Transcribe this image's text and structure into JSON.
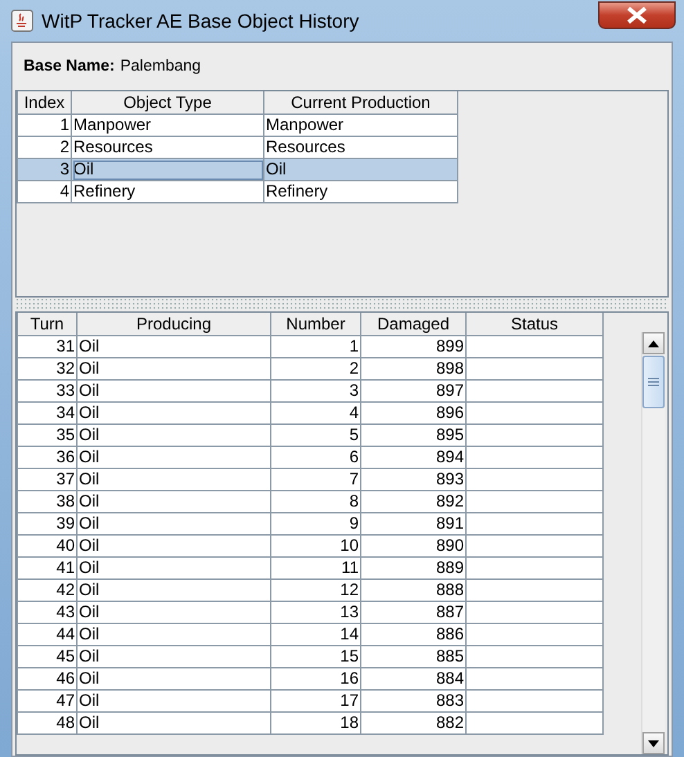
{
  "window": {
    "title": "WitP Tracker AE Base Object History"
  },
  "base_name": {
    "label": "Base Name:",
    "value": "Palembang"
  },
  "objects_table": {
    "columns": [
      "Index",
      "Object Type",
      "Current Production"
    ],
    "rows": [
      {
        "cells": [
          "1",
          "Manpower",
          "Manpower"
        ],
        "selected": false
      },
      {
        "cells": [
          "2",
          "Resources",
          "Resources"
        ],
        "selected": false
      },
      {
        "cells": [
          "3",
          "Oil",
          "Oil"
        ],
        "selected": true
      },
      {
        "cells": [
          "4",
          "Refinery",
          "Refinery"
        ],
        "selected": false
      }
    ]
  },
  "history_table": {
    "columns": [
      "Turn",
      "Producing",
      "Number",
      "Damaged",
      "Status"
    ],
    "rows": [
      [
        "31",
        "Oil",
        "1",
        "899"
      ],
      [
        "32",
        "Oil",
        "2",
        "898"
      ],
      [
        "33",
        "Oil",
        "3",
        "897"
      ],
      [
        "34",
        "Oil",
        "4",
        "896"
      ],
      [
        "35",
        "Oil",
        "5",
        "895"
      ],
      [
        "36",
        "Oil",
        "6",
        "894"
      ],
      [
        "37",
        "Oil",
        "7",
        "893"
      ],
      [
        "38",
        "Oil",
        "8",
        "892"
      ],
      [
        "39",
        "Oil",
        "9",
        "891"
      ],
      [
        "40",
        "Oil",
        "10",
        "890"
      ],
      [
        "41",
        "Oil",
        "11",
        "889"
      ],
      [
        "42",
        "Oil",
        "12",
        "888"
      ],
      [
        "43",
        "Oil",
        "13",
        "887"
      ],
      [
        "44",
        "Oil",
        "14",
        "886"
      ],
      [
        "45",
        "Oil",
        "15",
        "885"
      ],
      [
        "46",
        "Oil",
        "16",
        "884"
      ],
      [
        "47",
        "Oil",
        "17",
        "883"
      ],
      [
        "48",
        "Oil",
        "18",
        "882"
      ]
    ]
  }
}
